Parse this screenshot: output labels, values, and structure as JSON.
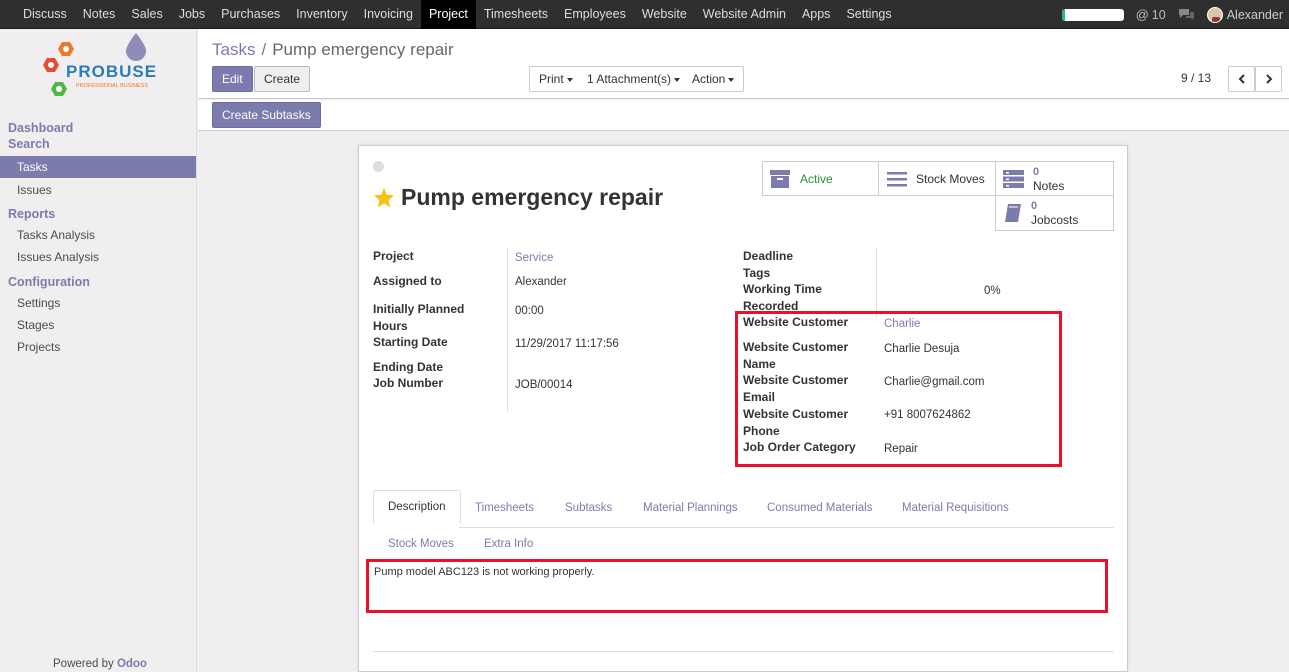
{
  "topbar": {
    "menu": [
      "Discuss",
      "Notes",
      "Sales",
      "Jobs",
      "Purchases",
      "Inventory",
      "Invoicing",
      "Project",
      "Timesheets",
      "Employees",
      "Website",
      "Website Admin",
      "Apps",
      "Settings"
    ],
    "active_menu": "Project",
    "progress_fraction": 0.06,
    "mention_count": "10",
    "user_name": "Alexander"
  },
  "logo": {
    "brand": "PROBUSE",
    "tagline": "PROFESSIONAL BUSINESS"
  },
  "sidebar": {
    "heading1_line1": "Dashboard",
    "heading1_line2": "Search",
    "tasks": "Tasks",
    "issues": "Issues",
    "reports_heading": "Reports",
    "tasks_analysis": "Tasks Analysis",
    "issues_analysis": "Issues Analysis",
    "config_heading": "Configuration",
    "settings": "Settings",
    "stages": "Stages",
    "projects": "Projects",
    "powered_by": "Powered by",
    "powered_brand": "Odoo"
  },
  "breadcrumb": {
    "parent": "Tasks",
    "separator": "/",
    "current": "Pump emergency repair"
  },
  "buttons": {
    "edit": "Edit",
    "create": "Create",
    "print": "Print",
    "attachments": "1 Attachment(s)",
    "action": "Action",
    "create_subtasks": "Create Subtasks"
  },
  "pager": "9 / 13",
  "record": {
    "title": "Pump emergency repair",
    "smart": {
      "active": "Active",
      "stock_moves": "Stock Moves",
      "notes_count": "0",
      "notes": "Notes",
      "jobcosts_count": "0",
      "jobcosts": "Jobcosts"
    },
    "left_fields": {
      "project_label": "Project",
      "project_value": "Service",
      "assigned_label": "Assigned to",
      "assigned_value": "Alexander",
      "planned_label_1": "Initially Planned",
      "planned_label_2": "Hours",
      "planned_value": "00:00",
      "start_label": "Starting Date",
      "start_value": "11/29/2017 11:17:56",
      "end_label": "Ending Date",
      "job_label": "Job Number",
      "job_value": "JOB/00014"
    },
    "right_fields": {
      "deadline_label": "Deadline",
      "tags_label": "Tags",
      "working_label_1": "Working Time",
      "working_label_2": "Recorded",
      "working_value": "0%",
      "wc_label": "Website Customer",
      "wc_value": "Charlie",
      "wcn_label_1": "Website Customer",
      "wcn_label_2": "Name",
      "wcn_value": "Charlie Desuja",
      "wce_label_1": "Website Customer",
      "wce_label_2": "Email",
      "wce_value": "Charlie@gmail.com",
      "wcp_label_1": "Website Customer",
      "wcp_label_2": "Phone",
      "wcp_value": "+91 8007624862",
      "joc_label": "Job Order Category",
      "joc_value": "Repair"
    },
    "tabs": [
      "Description",
      "Timesheets",
      "Subtasks",
      "Material Plannings",
      "Consumed Materials",
      "Material Requisitions",
      "Stock Moves",
      "Extra Info"
    ],
    "description": "Pump model ABC123 is not working properly."
  },
  "colors": {
    "accent": "#7c7bad",
    "highlight": "#e8102b",
    "active_green": "#2c8c3c"
  }
}
